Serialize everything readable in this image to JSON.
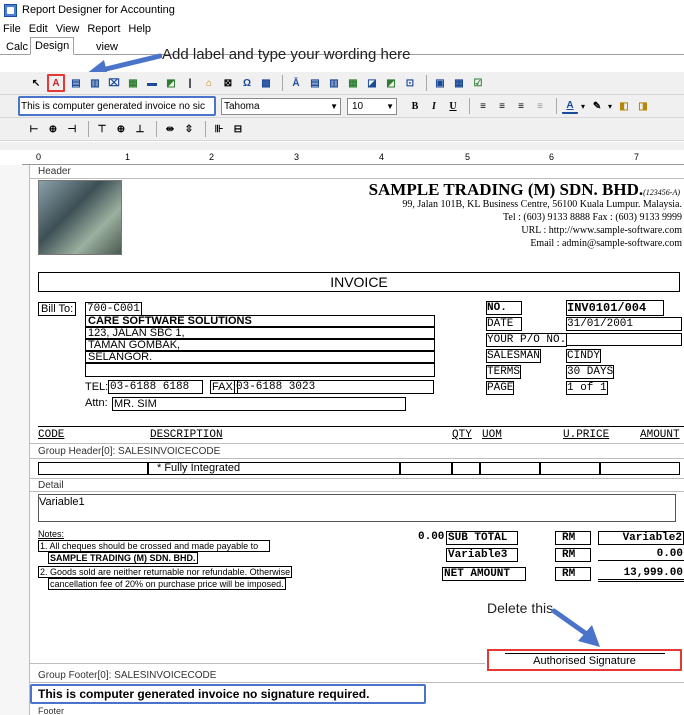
{
  "window": {
    "title": "Report Designer for Accounting"
  },
  "menu": [
    "File",
    "Edit",
    "View",
    "Report",
    "Help"
  ],
  "tabs": {
    "calc": "Calc",
    "design": "Design",
    "preview": "view"
  },
  "annotations": {
    "add_label": "Add label and type your wording here",
    "delete_this": "Delete this"
  },
  "format": {
    "text_value": "This is computer generated invoice no sic",
    "font": "Tahoma",
    "size": "10"
  },
  "ruler": [
    "0",
    "1",
    "2",
    "3",
    "4",
    "5",
    "6",
    "7"
  ],
  "bands": {
    "header": "Header",
    "group_header": "Group Header[0]: SALESINVOICECODE",
    "detail": "Detail",
    "group_footer": "Group Footer[0]: SALESINVOICECODE",
    "footer": "Footer"
  },
  "company": {
    "name": "SAMPLE TRADING (M) SDN. BHD.",
    "reg": "(123456-A)",
    "address": "99, Jalan 101B,  KL Business Centre, 56100 Kuala Lumpur. Malaysia.",
    "phone": "Tel : (603) 9133 8888 Fax : (603) 9133 9999",
    "url": "URL : http://www.sample-software.com",
    "email": "Email : admin@sample-software.com"
  },
  "invoice": {
    "title": "INVOICE",
    "bill_to_label": "Bill To:",
    "account": "700-C001",
    "customer": "CARE SOFTWARE SOLUTIONS",
    "addr1": "123, JALAN SBC 1,",
    "addr2": "TAMAN GOMBAK,",
    "addr3": "SELANGOR.",
    "tel_label": "TEL:",
    "tel": "03-6188 6188",
    "fax_label": "FAX:",
    "fax": "03-6188 3023",
    "attn_label": "Attn:",
    "attn": "MR. SIM"
  },
  "meta": {
    "no_label": "NO.",
    "no": "INV0101/004",
    "date_label": "DATE",
    "date": "31/01/2001",
    "po_label": "YOUR P/O NO.",
    "salesman_label": "SALESMAN",
    "salesman": "CINDY",
    "terms_label": "TERMS",
    "terms": "30 DAYS",
    "page_label": "PAGE",
    "page": "1 of 1"
  },
  "columns": {
    "code": "CODE",
    "description": "DESCRIPTION",
    "qty": "QTY",
    "uom": "UOM",
    "price": "U.PRICE",
    "amount": "AMOUNT"
  },
  "group": {
    "fully_integrated": "* Fully Integrated"
  },
  "detail": {
    "variable": "Variable1"
  },
  "notes": {
    "title": "Notes:",
    "n1a": "1.  All cheques should be crossed and made payable to",
    "n1b": "SAMPLE TRADING (M) SDN. BHD.",
    "n2a": "2.  Goods sold are neither returnable nor refundable. Otherwise",
    "n2b": "cancellation fee of 20% on purchase price will be imposed."
  },
  "totals": {
    "zero": "0.00",
    "sub_total": "SUB TOTAL",
    "variable3": "Variable3",
    "net_amount": "NET AMOUNT",
    "rm": "RM",
    "variable2": "Variable2",
    "v_zero": "0.00",
    "net": "13,999.00"
  },
  "signature": "Authorised Signature",
  "footer_text": "This is computer generated invoice no signature required."
}
